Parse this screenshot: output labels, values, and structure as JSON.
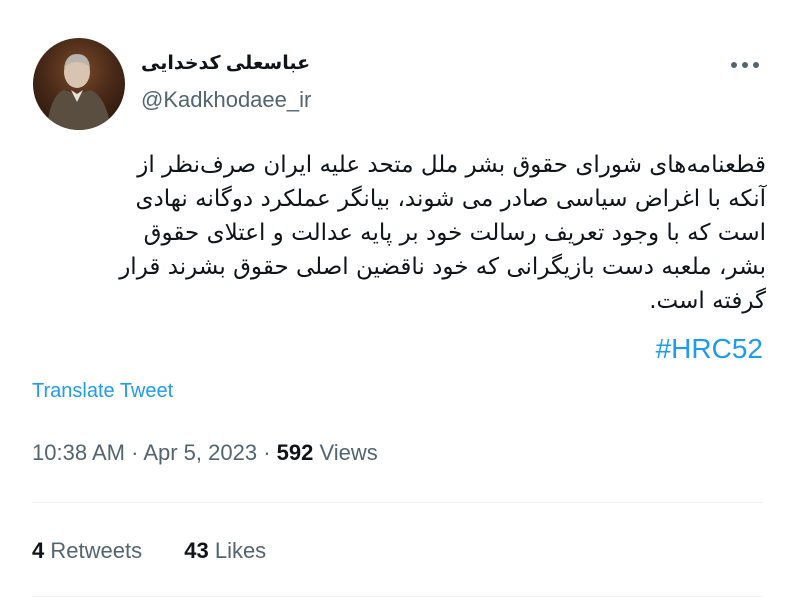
{
  "author": {
    "display_name": "عباسعلی کدخدایی",
    "handle": "@Kadkhodaee_ir"
  },
  "tweet": {
    "text_lines": [
      "قطعنامه‌های شورای حقوق بشر ملل متحد علیه ایران صرف‌نظر از",
      "آنکه با اغراض سیاسی صادر می شوند، بیانگر عملکرد دوگانه نهادی",
      "است که با وجود تعریف رسالت خود بر پایه عدالت و اعتلای حقوق",
      "بشر، ملعبه دست بازیگرانی که خود ناقضین اصلی حقوق بشرند قرار",
      "گرفته است."
    ],
    "hashtag": "#HRC52"
  },
  "translate_label": "Translate Tweet",
  "meta": {
    "time": "10:38 AM",
    "separator": "·",
    "date": "Apr 5, 2023",
    "views_count": "592",
    "views_label": "Views"
  },
  "stats": {
    "retweets_count": "4",
    "retweets_label": "Retweets",
    "likes_count": "43",
    "likes_label": "Likes"
  },
  "colors": {
    "accent": "#1d9bf0",
    "text": "#0f1419",
    "secondary_text": "#536471",
    "divider": "#eff3f4"
  },
  "icons": {
    "more": "more-horizontal-icon"
  }
}
